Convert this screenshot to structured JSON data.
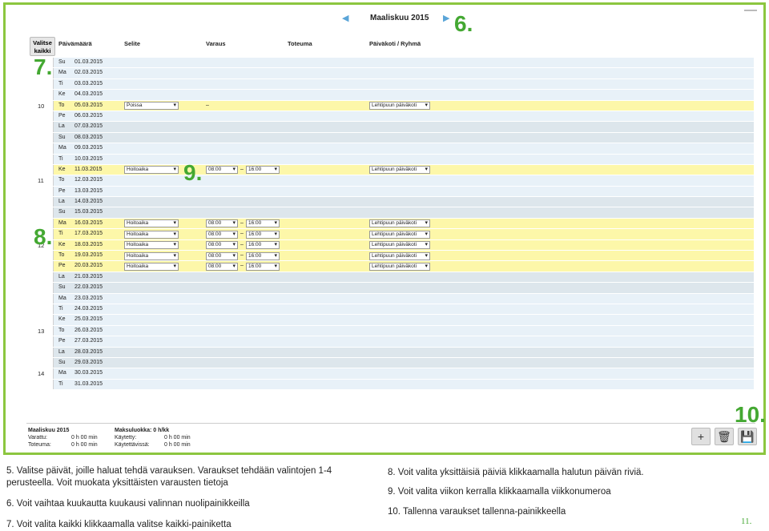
{
  "nav": {
    "month_title": "Maaliskuu 2015",
    "prev_symbol": "◀",
    "next_symbol": "▶"
  },
  "callouts": {
    "c6": "6.",
    "c7": "7.",
    "c8": "8.",
    "c9": "9.",
    "c10": "10."
  },
  "select_all": {
    "line1": "Valitse",
    "line2": "kaikki"
  },
  "columns": [
    "Päivämäärä",
    "Selite",
    "Varaus",
    "Toteuma",
    "Päiväkoti / Ryhmä"
  ],
  "rows": [
    {
      "day": "Su",
      "date": "01.03.2015",
      "bg": "bg-blue"
    },
    {
      "day": "Ma",
      "date": "02.03.2015",
      "bg": "bg-blue"
    },
    {
      "day": "Ti",
      "date": "03.03.2015",
      "bg": "bg-blue"
    },
    {
      "day": "Ke",
      "date": "04.03.2015",
      "bg": "bg-blue"
    },
    {
      "day": "To",
      "date": "05.03.2015",
      "bg": "bg-yellow",
      "week": "10",
      "selite": "Poissa",
      "dash_only": "–",
      "pkg": "Lehtipuun päiväkoti"
    },
    {
      "day": "Pe",
      "date": "06.03.2015",
      "bg": "bg-blue"
    },
    {
      "day": "La",
      "date": "07.03.2015",
      "bg": "bg-grey"
    },
    {
      "day": "Su",
      "date": "08.03.2015",
      "bg": "bg-grey"
    },
    {
      "day": "Ma",
      "date": "09.03.2015",
      "bg": "bg-blue"
    },
    {
      "day": "Ti",
      "date": "10.03.2015",
      "bg": "bg-blue"
    },
    {
      "day": "Ke",
      "date": "11.03.2015",
      "bg": "bg-yellow",
      "selite": "Hoitoaika",
      "start": "08:00",
      "end": "16:00",
      "pkg": "Lehtipuun päiväkoti"
    },
    {
      "day": "To",
      "date": "12.03.2015",
      "bg": "bg-blue",
      "week": "11"
    },
    {
      "day": "Pe",
      "date": "13.03.2015",
      "bg": "bg-blue"
    },
    {
      "day": "La",
      "date": "14.03.2015",
      "bg": "bg-grey"
    },
    {
      "day": "Su",
      "date": "15.03.2015",
      "bg": "bg-grey"
    },
    {
      "day": "Ma",
      "date": "16.03.2015",
      "bg": "bg-yellow",
      "selite": "Hoitoaika",
      "start": "08:00",
      "end": "16:00",
      "pkg": "Lehtipuun päiväkoti"
    },
    {
      "day": "Ti",
      "date": "17.03.2015",
      "bg": "bg-yellow",
      "selite": "Hoitoaika",
      "start": "08:00",
      "end": "16:00",
      "pkg": "Lehtipuun päiväkoti"
    },
    {
      "day": "Ke",
      "date": "18.03.2015",
      "bg": "bg-yellow",
      "week": "12",
      "selite": "Hoitoaika",
      "start": "08:00",
      "end": "16:00",
      "pkg": "Lehtipuun päiväkoti"
    },
    {
      "day": "To",
      "date": "19.03.2015",
      "bg": "bg-yellow",
      "selite": "Hoitoaika",
      "start": "08:00",
      "end": "16:00",
      "pkg": "Lehtipuun päiväkoti"
    },
    {
      "day": "Pe",
      "date": "20.03.2015",
      "bg": "bg-yellow",
      "selite": "Hoitoaika",
      "start": "08:00",
      "end": "16:00",
      "pkg": "Lehtipuun päiväkoti"
    },
    {
      "day": "La",
      "date": "21.03.2015",
      "bg": "bg-grey"
    },
    {
      "day": "Su",
      "date": "22.03.2015",
      "bg": "bg-grey"
    },
    {
      "day": "Ma",
      "date": "23.03.2015",
      "bg": "bg-blue"
    },
    {
      "day": "Ti",
      "date": "24.03.2015",
      "bg": "bg-blue"
    },
    {
      "day": "Ke",
      "date": "25.03.2015",
      "bg": "bg-blue"
    },
    {
      "day": "To",
      "date": "26.03.2015",
      "bg": "bg-blue",
      "week": "13"
    },
    {
      "day": "Pe",
      "date": "27.03.2015",
      "bg": "bg-blue"
    },
    {
      "day": "La",
      "date": "28.03.2015",
      "bg": "bg-grey"
    },
    {
      "day": "Su",
      "date": "29.03.2015",
      "bg": "bg-grey"
    },
    {
      "day": "Ma",
      "date": "30.03.2015",
      "bg": "bg-blue",
      "week": "14"
    },
    {
      "day": "Ti",
      "date": "31.03.2015",
      "bg": "bg-blue"
    }
  ],
  "time_separator": "–",
  "summary": {
    "month": "Maaliskuu 2015",
    "varattu_label": "Varattu:",
    "varattu_value": "0 h 00 min",
    "toteuma_label": "Toteuma:",
    "toteuma_value": "0 h 00 min",
    "maksuluokka": "Maksuluokka: 0 h/kk",
    "kaytetty_label": "Käytetty:",
    "kaytetty_value": "0 h 00 min",
    "kaytettavissa_label": "Käytettävissä:",
    "kaytettavissa_value": "0 h 00 min"
  },
  "tools": {
    "add": "+",
    "delete": "🗑",
    "save": "💾"
  },
  "instructions": {
    "i5a": "5.  Valitse päivät, joille haluat tehdä varauksen. Varaukset tehdään valintojen 1-4",
    "i5b": "     perusteella. Voit muokata yksittäisten varausten tietoja",
    "i6": "6.  Voit vaihtaa kuukautta kuukausi valinnan nuolipainikkeilla",
    "i7": "7.  Voit valita kaikki klikkaamalla valitse kaikki-painiketta",
    "i8": "8.  Voit valita yksittäisiä päiviä klikkaamalla halutun päivän riviä.",
    "i9": "9.  Voit valita viikon kerralla klikkaamalla viikkonumeroa",
    "i10": "10. Tallenna varaukset tallenna-painikkeella"
  },
  "page_number": "11."
}
